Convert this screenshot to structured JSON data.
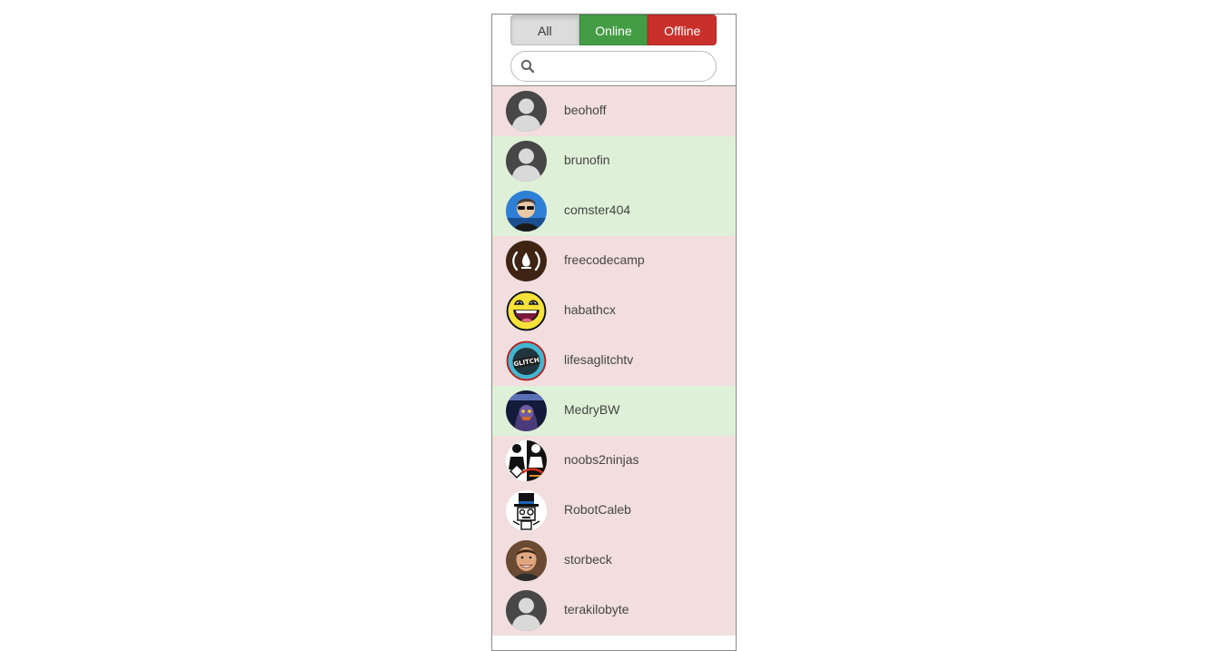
{
  "filters": {
    "all_label": "All",
    "online_label": "Online",
    "offline_label": "Offline",
    "active": "All"
  },
  "search": {
    "placeholder": "",
    "value": ""
  },
  "colors": {
    "online_row": "#dff0d8",
    "offline_row": "#f2dede",
    "online_button": "#449d44",
    "offline_button": "#c9302c"
  },
  "streamers": [
    {
      "name": "beohoff",
      "status": "offline",
      "avatar": "default-avatar-icon"
    },
    {
      "name": "brunofin",
      "status": "online",
      "avatar": "default-avatar-icon"
    },
    {
      "name": "comster404",
      "status": "online",
      "avatar": "person-sunglasses-avatar"
    },
    {
      "name": "freecodecamp",
      "status": "offline",
      "avatar": "flame-logo-avatar"
    },
    {
      "name": "habathcx",
      "status": "offline",
      "avatar": "laughing-face-avatar"
    },
    {
      "name": "lifesaglitchtv",
      "status": "offline",
      "avatar": "glitch-logo-avatar"
    },
    {
      "name": "MedryBW",
      "status": "online",
      "avatar": "starcraft-avatar"
    },
    {
      "name": "noobs2ninjas",
      "status": "offline",
      "avatar": "ninja-logo-avatar"
    },
    {
      "name": "RobotCaleb",
      "status": "offline",
      "avatar": "robot-tophat-avatar"
    },
    {
      "name": "storbeck",
      "status": "offline",
      "avatar": "man-portrait-avatar"
    },
    {
      "name": "terakilobyte",
      "status": "offline",
      "avatar": "default-avatar-icon"
    }
  ]
}
